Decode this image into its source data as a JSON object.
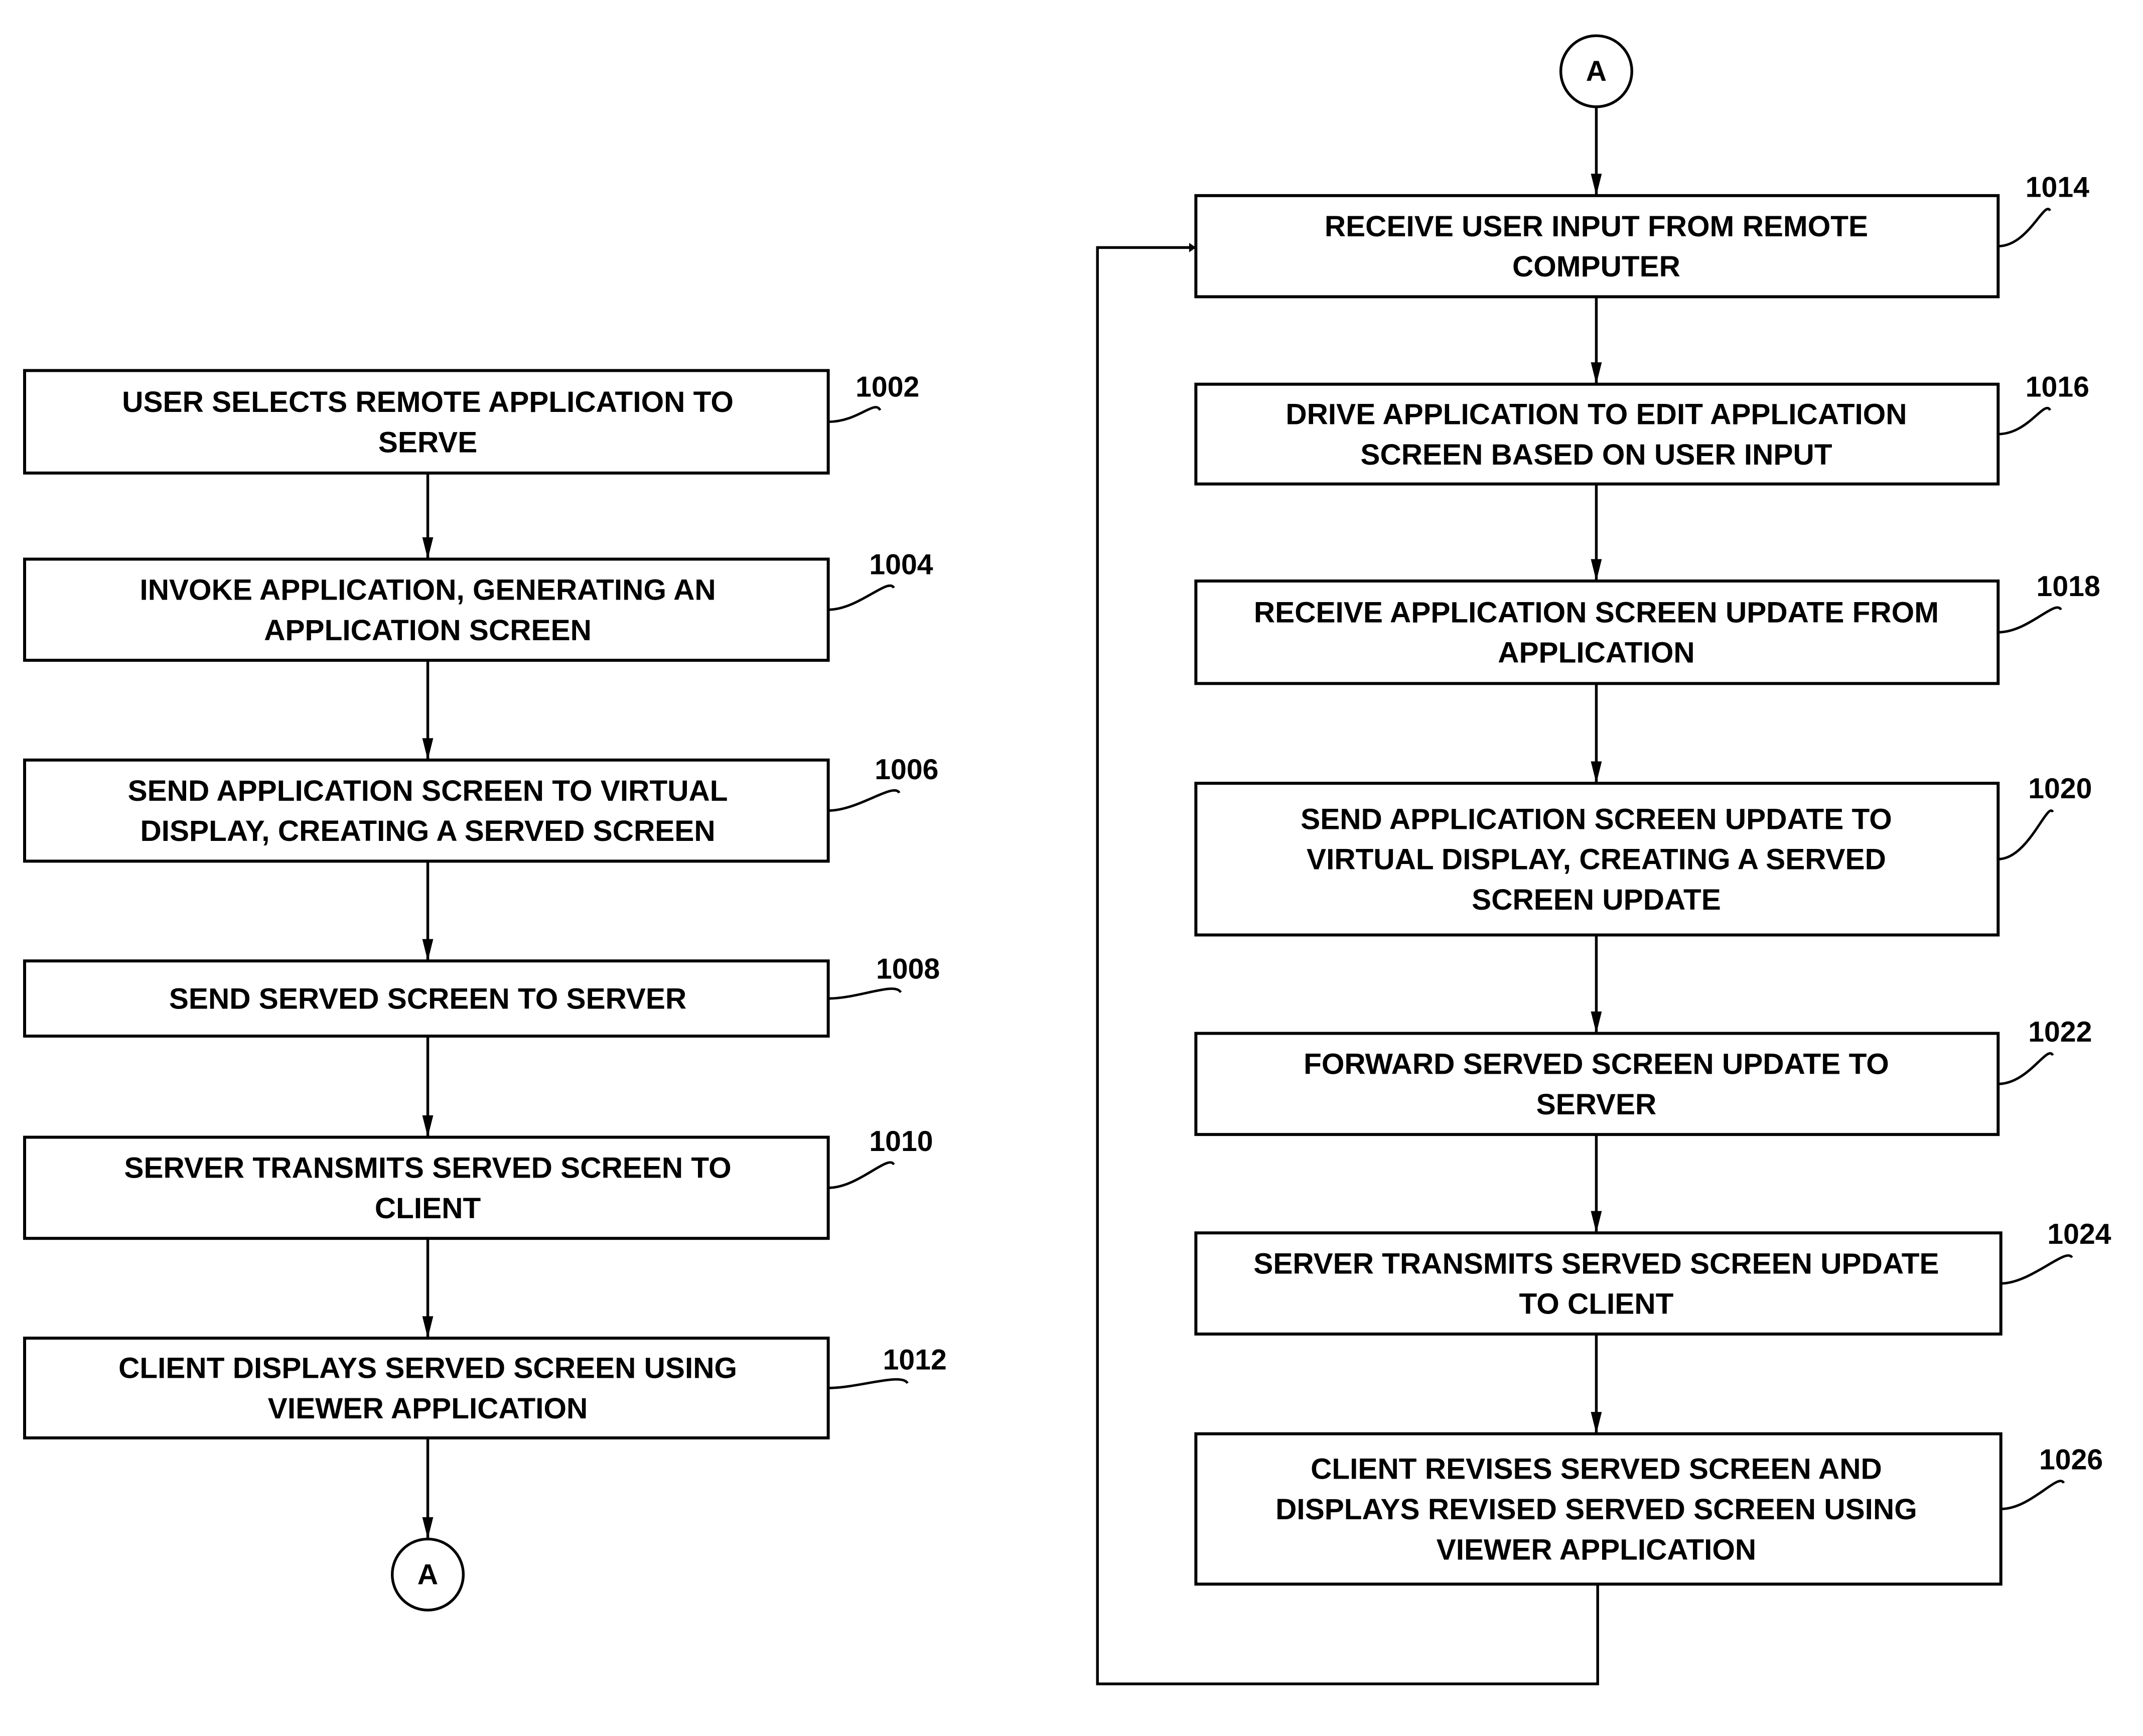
{
  "diagram": {
    "type": "flowchart",
    "connector_label": "A",
    "left_column": [
      {
        "ref": "1002",
        "lines": [
          "USER SELECTS REMOTE APPLICATION TO",
          "SERVE"
        ]
      },
      {
        "ref": "1004",
        "lines": [
          "INVOKE APPLICATION, GENERATING AN",
          "APPLICATION SCREEN"
        ]
      },
      {
        "ref": "1006",
        "lines": [
          "SEND APPLICATION SCREEN TO  VIRTUAL",
          "DISPLAY, CREATING A SERVED SCREEN"
        ]
      },
      {
        "ref": "1008",
        "lines": [
          "SEND SERVED SCREEN TO SERVER"
        ]
      },
      {
        "ref": "1010",
        "lines": [
          "SERVER TRANSMITS SERVED SCREEN TO",
          "CLIENT"
        ]
      },
      {
        "ref": "1012",
        "lines": [
          "CLIENT DISPLAYS SERVED SCREEN USING",
          "VIEWER APPLICATION"
        ]
      }
    ],
    "right_column": [
      {
        "ref": "1014",
        "lines": [
          "RECEIVE USER INPUT FROM REMOTE",
          "COMPUTER"
        ]
      },
      {
        "ref": "1016",
        "lines": [
          "DRIVE APPLICATION TO EDIT APPLICATION",
          "SCREEN BASED ON USER INPUT"
        ]
      },
      {
        "ref": "1018",
        "lines": [
          "RECEIVE APPLICATION SCREEN UPDATE FROM",
          "APPLICATION"
        ]
      },
      {
        "ref": "1020",
        "lines": [
          "SEND APPLICATION SCREEN UPDATE TO",
          "VIRTUAL DISPLAY, CREATING A SERVED",
          "SCREEN UPDATE"
        ]
      },
      {
        "ref": "1022",
        "lines": [
          "FORWARD SERVED SCREEN UPDATE TO",
          "SERVER"
        ]
      },
      {
        "ref": "1024",
        "lines": [
          "SERVER TRANSMITS SERVED SCREEN UPDATE",
          "TO CLIENT"
        ]
      },
      {
        "ref": "1026",
        "lines": [
          "CLIENT REVISES SERVED SCREEN AND",
          "DISPLAYS REVISED SERVED SCREEN USING",
          "VIEWER APPLICATION"
        ]
      }
    ]
  }
}
